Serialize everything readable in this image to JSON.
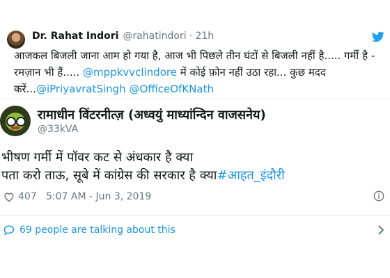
{
  "quoted_tweet": {
    "author_name": "Dr. Rahat Indori",
    "handle": "@rahatindori",
    "time": "· 21h",
    "text_segments": [
      {
        "type": "text",
        "value": "आजकल बिजली जाना आम हो गया है, आज भी पिछले तीन घंटों से बिजली नहीं है..... गर्मी है - रमज़ान भी हैं..... "
      },
      {
        "type": "mention",
        "value": "@mppkvvclindore"
      },
      {
        "type": "text",
        "value": " में कोई फ़ोन नहीं उठा रहा... कुछ मदद करें..."
      },
      {
        "type": "mention",
        "value": "@iPriyavratSingh"
      },
      {
        "type": "text",
        "value": " "
      },
      {
        "type": "mention",
        "value": "@OfficeOfKNath"
      }
    ]
  },
  "main_tweet": {
    "author_name": "रामाधीन विंटरनीत्ज़ (अध्वयुं माध्यांन्दिन वाजसनेय)",
    "handle": "@33kVA",
    "line1": "भीषण गर्मी में पॉवर कट से अंधकार है क्या",
    "line2": "पता करो ताऊ, सूबे में कांग्रेस की सरकार है क्या",
    "hashtag": "#आहत_इंदौरी",
    "likes": "407",
    "timestamp": "5:07 AM - Jun 3, 2019"
  },
  "talking": {
    "label": "69 people are talking about this"
  },
  "icons": {
    "brand": "twitter-bird-icon",
    "like": "heart-icon",
    "info": "info-icon",
    "reply": "speech-bubble-icon",
    "chevron": "chevron-right-icon"
  },
  "colors": {
    "link": "#1b95e0",
    "muted": "#657786",
    "twitter_blue": "#1da1f2"
  }
}
